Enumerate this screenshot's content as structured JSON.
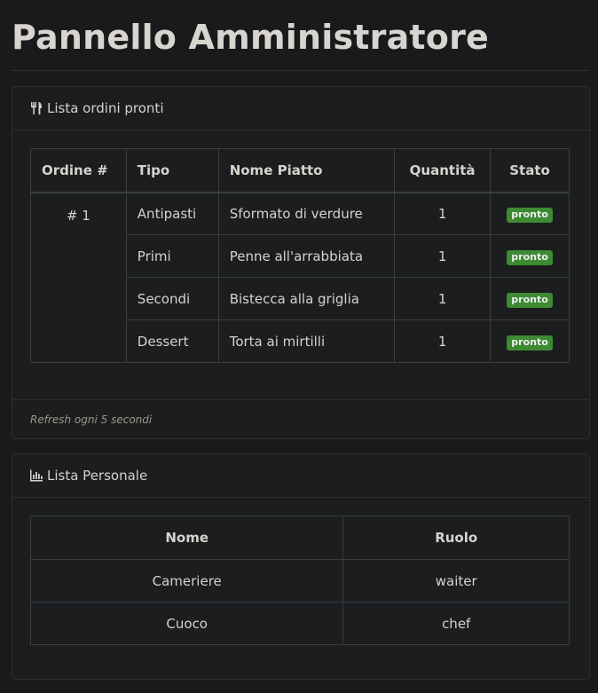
{
  "page": {
    "title": "Pannello Amministratore"
  },
  "orders_card": {
    "icon": "utensils-icon",
    "title": "Lista ordini pronti",
    "columns": [
      "Ordine #",
      "Tipo",
      "Nome Piatto",
      "Quantità",
      "Stato"
    ],
    "order_number": "# 1",
    "rows": [
      {
        "tipo": "Antipasti",
        "piatto": "Sformato di verdure",
        "quantita": "1",
        "stato": "pronto"
      },
      {
        "tipo": "Primi",
        "piatto": "Penne all'arrabbiata",
        "quantita": "1",
        "stato": "pronto"
      },
      {
        "tipo": "Secondi",
        "piatto": "Bistecca alla griglia",
        "quantita": "1",
        "stato": "pronto"
      },
      {
        "tipo": "Dessert",
        "piatto": "Torta ai mirtilli",
        "quantita": "1",
        "stato": "pronto"
      }
    ],
    "footer": "Refresh ogni 5 secondi"
  },
  "staff_card": {
    "icon": "bar-chart-icon",
    "title": "Lista Personale",
    "columns": [
      "Nome",
      "Ruolo"
    ],
    "rows": [
      {
        "nome": "Cameriere",
        "ruolo": "waiter"
      },
      {
        "nome": "Cuoco",
        "ruolo": "chef"
      }
    ]
  },
  "colors": {
    "background": "#181a1b",
    "badge_green": "#3d8a33",
    "text": "#d6d3cd"
  }
}
